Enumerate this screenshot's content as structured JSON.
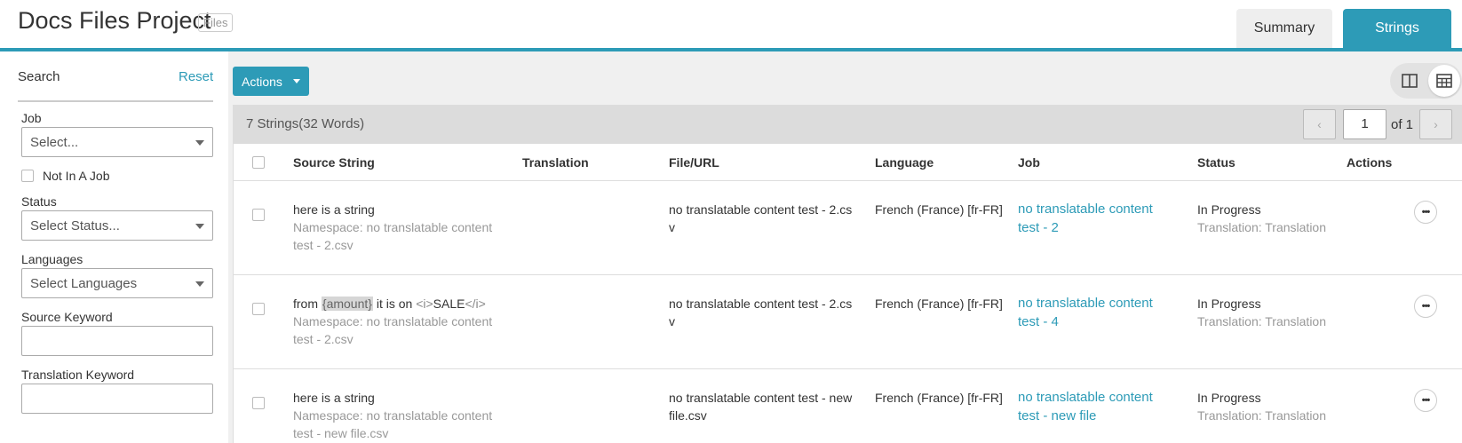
{
  "header": {
    "title": "Docs Files Project",
    "badge": "Files",
    "tabs": [
      {
        "label": "Summary",
        "active": false
      },
      {
        "label": "Strings",
        "active": true
      }
    ],
    "accent_color": "#2d9bb7"
  },
  "sidebar": {
    "search_label": "Search",
    "reset_label": "Reset",
    "job": {
      "label": "Job",
      "placeholder": "Select..."
    },
    "not_in_job_label": "Not In A Job",
    "status": {
      "label": "Status",
      "placeholder": "Select Status..."
    },
    "languages": {
      "label": "Languages",
      "placeholder": "Select Languages"
    },
    "source_keyword": {
      "label": "Source Keyword",
      "value": ""
    },
    "translation_keyword": {
      "label": "Translation Keyword",
      "value": ""
    }
  },
  "main": {
    "actions_label": "Actions",
    "view_icons": [
      "split-view-icon",
      "table-view-icon"
    ],
    "count_text": "7 Strings(32 Words)",
    "pager": {
      "current_page": "1",
      "of_text": "of 1"
    },
    "columns": [
      "Source String",
      "Translation",
      "File/URL",
      "Language",
      "Job",
      "Status",
      "Actions"
    ],
    "rows": [
      {
        "source": "here is a string",
        "namespace_line1": "Namespace: no translatable content",
        "namespace_line2": "test - 2.csv",
        "translation": "",
        "file_line1": "no translatable content test - 2.cs",
        "file_line2": "v",
        "language": "French (France) [fr-FR]",
        "job_line1": "no translatable content",
        "job_line2": "test - 2",
        "status": "In Progress",
        "status_sub": "Translation: Translation"
      },
      {
        "source_prefix": "from ",
        "source_placeholder": "{amount}",
        "source_middle": " it is on ",
        "source_tag_open": "<i>",
        "source_tag_text": "SALE",
        "source_tag_close": "</i>",
        "namespace_line1": "Namespace: no translatable content",
        "namespace_line2": "test - 2.csv",
        "translation": "",
        "file_line1": "no translatable content test - 2.cs",
        "file_line2": "v",
        "language": "French (France) [fr-FR]",
        "job_line1": "no translatable content",
        "job_line2": "test - 4",
        "status": "In Progress",
        "status_sub": "Translation: Translation"
      },
      {
        "source": "here is a string",
        "namespace_line1": "Namespace: no translatable content",
        "namespace_line2": "test - new file.csv",
        "translation": "",
        "file_line1": "no translatable content test - new",
        "file_line2": "file.csv",
        "language": "French (France) [fr-FR]",
        "job_line1": "no translatable content",
        "job_line2": "test - new file",
        "status": "In Progress",
        "status_sub": "Translation: Translation"
      }
    ]
  }
}
